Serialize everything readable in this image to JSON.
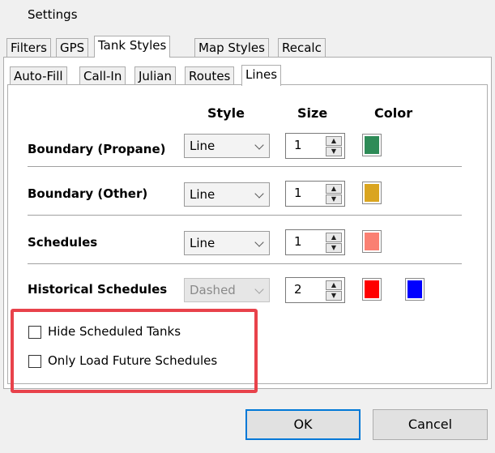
{
  "window": {
    "title": "Settings"
  },
  "outer_tabs": [
    "Filters",
    "GPS",
    "Tank Styles",
    "Map Styles",
    "Recalc"
  ],
  "outer_active": "Tank Styles",
  "inner_tabs": [
    "Auto-Fill",
    "Call-In",
    "Julian",
    "Routes",
    "Lines"
  ],
  "inner_active": "Lines",
  "columns": {
    "style": "Style",
    "size": "Size",
    "color": "Color"
  },
  "rows": [
    {
      "label": "Boundary (Propane)",
      "style": "Line",
      "size": "1",
      "colors": [
        "#2e8b57"
      ],
      "style_enabled": true
    },
    {
      "label": "Boundary (Other)",
      "style": "Line",
      "size": "1",
      "colors": [
        "#daa520"
      ],
      "style_enabled": true
    },
    {
      "label": "Schedules",
      "style": "Line",
      "size": "1",
      "colors": [
        "#fa8072"
      ],
      "style_enabled": true
    },
    {
      "label": "Historical Schedules",
      "style": "Dashed",
      "size": "2",
      "colors": [
        "#ff0000",
        "#0000ff"
      ],
      "style_enabled": false
    }
  ],
  "checkboxes": [
    {
      "label": "Hide Scheduled Tanks",
      "checked": false
    },
    {
      "label": "Only Load Future Schedules",
      "checked": false
    }
  ],
  "buttons": {
    "ok": "OK",
    "cancel": "Cancel"
  },
  "colors": {
    "highlight": "#e8424b",
    "default_button_border": "#0078d7"
  }
}
